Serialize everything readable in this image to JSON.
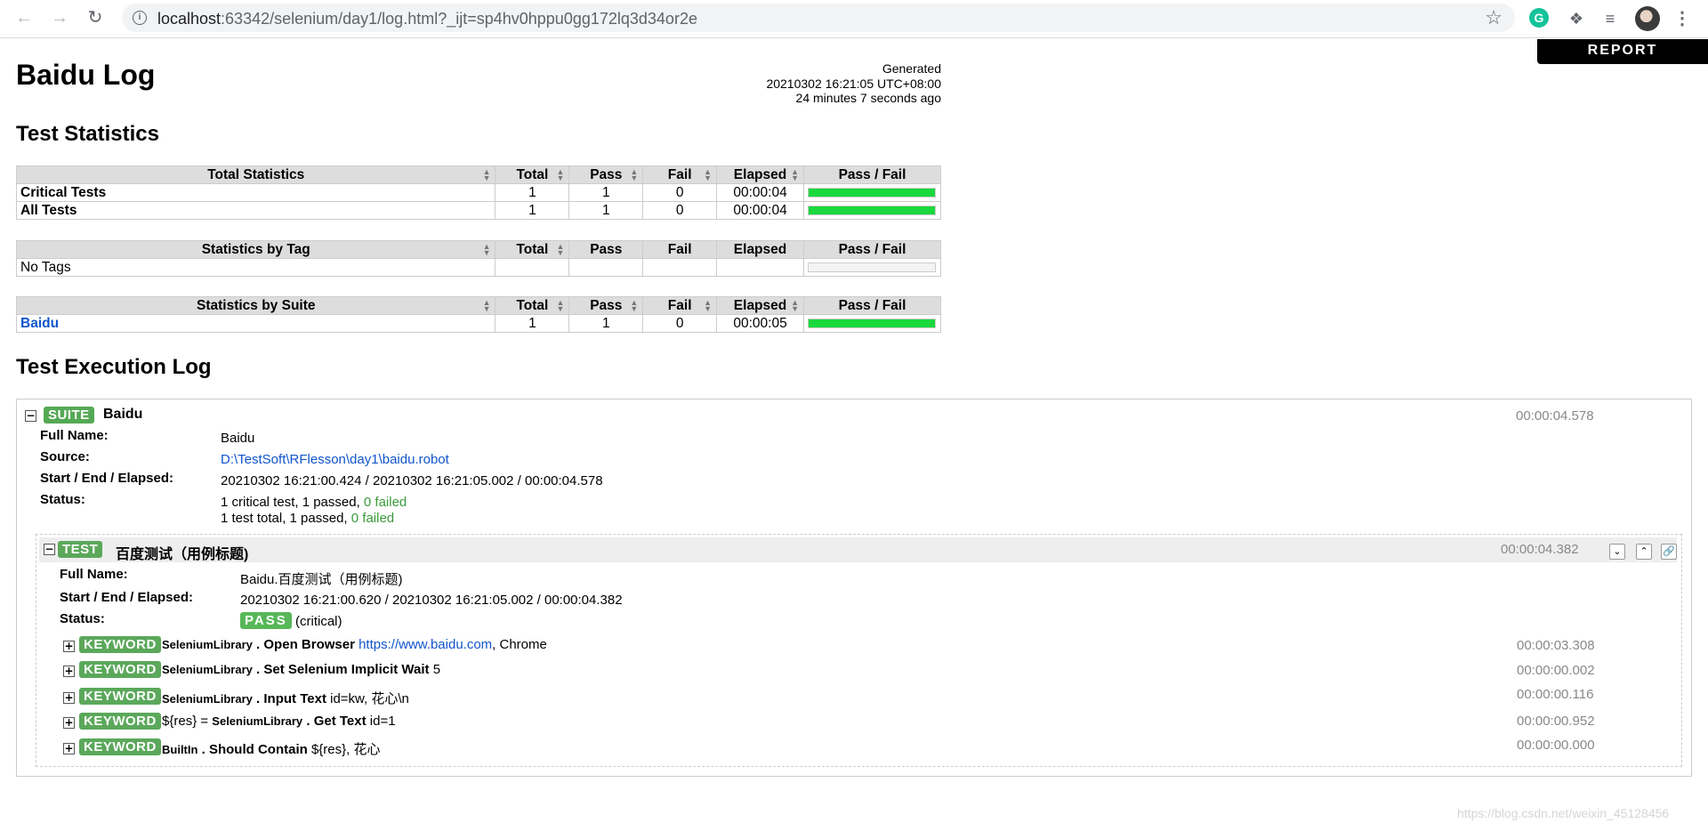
{
  "browser": {
    "url_host": "localhost",
    "url_rest": ":63342/selenium/day1/log.html?_ijt=sp4hv0hppu0gg172lq3d34or2e",
    "extension_letter": "G"
  },
  "report_button": "REPORT",
  "header": {
    "title": "Baidu Log",
    "generated_label": "Generated",
    "generated_time": "20210302 16:21:05 UTC+08:00",
    "generated_ago": "24 minutes 7 seconds ago"
  },
  "test_statistics": {
    "heading": "Test Statistics",
    "columns": [
      "Total",
      "Pass",
      "Fail",
      "Elapsed",
      "Pass / Fail"
    ],
    "total_stats": {
      "title": "Total Statistics",
      "rows": [
        {
          "name": "Critical Tests",
          "total": "1",
          "pass": "1",
          "fail": "0",
          "elapsed": "00:00:04",
          "pass_ratio": 1.0
        },
        {
          "name": "All Tests",
          "total": "1",
          "pass": "1",
          "fail": "0",
          "elapsed": "00:00:04",
          "pass_ratio": 1.0
        }
      ]
    },
    "by_tag": {
      "title": "Statistics by Tag",
      "rows": [
        {
          "name": "No Tags"
        }
      ]
    },
    "by_suite": {
      "title": "Statistics by Suite",
      "rows": [
        {
          "name": "Baidu",
          "total": "1",
          "pass": "1",
          "fail": "0",
          "elapsed": "00:00:05",
          "pass_ratio": 1.0
        }
      ]
    }
  },
  "execution_log": {
    "heading": "Test Execution Log",
    "suite": {
      "label": "SUITE",
      "name": "Baidu",
      "elapsed": "00:00:04.578",
      "meta": {
        "full_name_key": "Full Name:",
        "full_name": "Baidu",
        "source_key": "Source:",
        "source": "D:\\TestSoft\\RFlesson\\day1\\baidu.robot",
        "times_key": "Start / End / Elapsed:",
        "times": "20210302 16:21:00.424 / 20210302 16:21:05.002 / 00:00:04.578",
        "status_key": "Status:",
        "status_line1_a": "1 critical test, 1 passed, ",
        "status_line1_b": "0 failed",
        "status_line2_a": "1 test total, 1 passed, ",
        "status_line2_b": "0 failed"
      }
    },
    "test": {
      "label": "TEST",
      "name": "百度测试（用例标题)",
      "elapsed": "00:00:04.382",
      "meta": {
        "full_name_key": "Full Name:",
        "full_name": "Baidu.百度测试（用例标题)",
        "times_key": "Start / End / Elapsed:",
        "times": "20210302 16:21:00.620 / 20210302 16:21:05.002 / 00:00:04.382",
        "status_key": "Status:",
        "status_badge": "PASS",
        "status_note": "(critical)"
      },
      "keywords": [
        {
          "label": "KEYWORD",
          "assign": "",
          "lib": "SeleniumLibrary",
          "name": "Open Browser",
          "args_link": "https://www.baidu.com",
          "args": ", Chrome",
          "elapsed": "00:00:03.308"
        },
        {
          "label": "KEYWORD",
          "assign": "",
          "lib": "SeleniumLibrary",
          "name": "Set Selenium Implicit Wait",
          "args_link": "",
          "args": "5",
          "elapsed": "00:00:00.002"
        },
        {
          "label": "KEYWORD",
          "assign": "",
          "lib": "SeleniumLibrary",
          "name": "Input Text",
          "args_link": "",
          "args": "id=kw, 花心\\n",
          "elapsed": "00:00:00.116"
        },
        {
          "label": "KEYWORD",
          "assign": "${res} = ",
          "lib": "SeleniumLibrary",
          "name": "Get Text",
          "args_link": "",
          "args": "id=1",
          "elapsed": "00:00:00.952"
        },
        {
          "label": "KEYWORD",
          "assign": "",
          "lib": "BuiltIn",
          "name": "Should Contain",
          "args_link": "",
          "args": "${res}, 花心",
          "elapsed": "00:00:00.000"
        }
      ]
    }
  },
  "watermark": "https://blog.csdn.net/weixin_45128456",
  "colors": {
    "pass": "#1bd83d",
    "label_green": "#5ba85b",
    "link": "#1155cc"
  }
}
